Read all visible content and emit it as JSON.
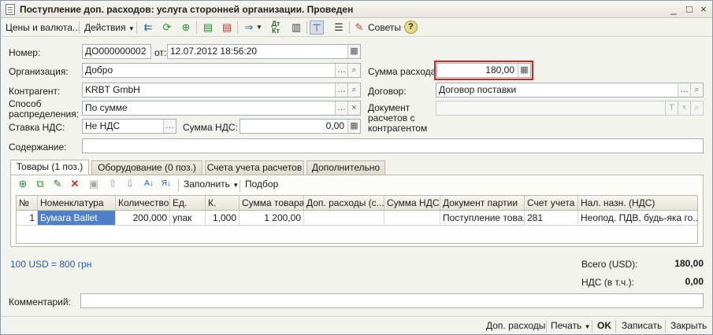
{
  "window": {
    "title": "Поступление доп. расходов: услуга сторонней организации. Проведен",
    "controls": {
      "minimize": "_",
      "maximize": "□",
      "close": "×"
    }
  },
  "toolbar": {
    "prices_currency": "Цены и валюта...",
    "actions": "Действия",
    "advice": "Советы",
    "icons": [
      "list-icon",
      "refresh-icon",
      "add-document-icon",
      "post-icon",
      "unpost-icon",
      "structure-icon",
      "debit-credit-icon",
      "report-icon",
      "filter-icon",
      "table-icon",
      "advice-icon",
      "help-icon"
    ],
    "dtkt_label": "Дт Кт"
  },
  "form": {
    "number_label": "Номер:",
    "number_value": "ДО000000002",
    "date_prefix": "от:",
    "date_value": "12.07.2012 18:56:20",
    "org_label": "Организация:",
    "org_value": "Добро",
    "counterparty_label": "Контрагент:",
    "counterparty_value": "KRBT GmbH",
    "distribution_label_1": "Способ",
    "distribution_label_2": "распределения:",
    "distribution_value": "По сумме",
    "vat_rate_label": "Ставка НДС:",
    "vat_rate_value": "Не НДС",
    "vat_sum_label": "Сумма НДС:",
    "vat_sum_value": "0,00",
    "expense_sum_label": "Сумма расхода:",
    "expense_sum_value": "180,00",
    "contract_label": "Договор:",
    "contract_value": "Договор поставки",
    "settlement_doc_label_1": "Документ",
    "settlement_doc_label_2": "расчетов с",
    "settlement_doc_label_3": "контрагентом",
    "settlement_doc_value": "",
    "content_label": "Содержание:",
    "content_value": "",
    "comment_label": "Комментарий:",
    "comment_value": ""
  },
  "tabs": [
    {
      "label": "Товары (1 поз.)",
      "active": true
    },
    {
      "label": "Оборудование (0 поз.)",
      "active": false
    },
    {
      "label": "Счета учета расчетов",
      "active": false
    },
    {
      "label": "Дополнительно",
      "active": false
    }
  ],
  "table_toolbar": {
    "fill": "Заполнить",
    "selection": "Подбор"
  },
  "table": {
    "columns": [
      "№",
      "Номенклатура",
      "Количество",
      "Ед.",
      "К.",
      "Сумма товара",
      "Доп. расходы (с...",
      "Сумма НДС",
      "Документ партии",
      "Счет учета",
      "Нал. назн. (НДС)"
    ],
    "rows": [
      [
        "1",
        "Бумага Ballet",
        "200,000",
        "упак",
        "1,000",
        "1 200,00",
        "",
        "",
        "Поступление това...",
        "281",
        "Неопод. ПДВ, будь-яка го..."
      ]
    ]
  },
  "rate_text": "100 USD = 800 грн",
  "totals": {
    "total_label": "Всего (USD):",
    "total_value": "180,00",
    "vat_label": "НДС (в т.ч.):",
    "vat_value": "0,00"
  },
  "bottom": {
    "extra_expenses": "Доп. расходы",
    "print": "Печать",
    "ok": "OK",
    "save": "Записать",
    "close": "Закрыть"
  }
}
